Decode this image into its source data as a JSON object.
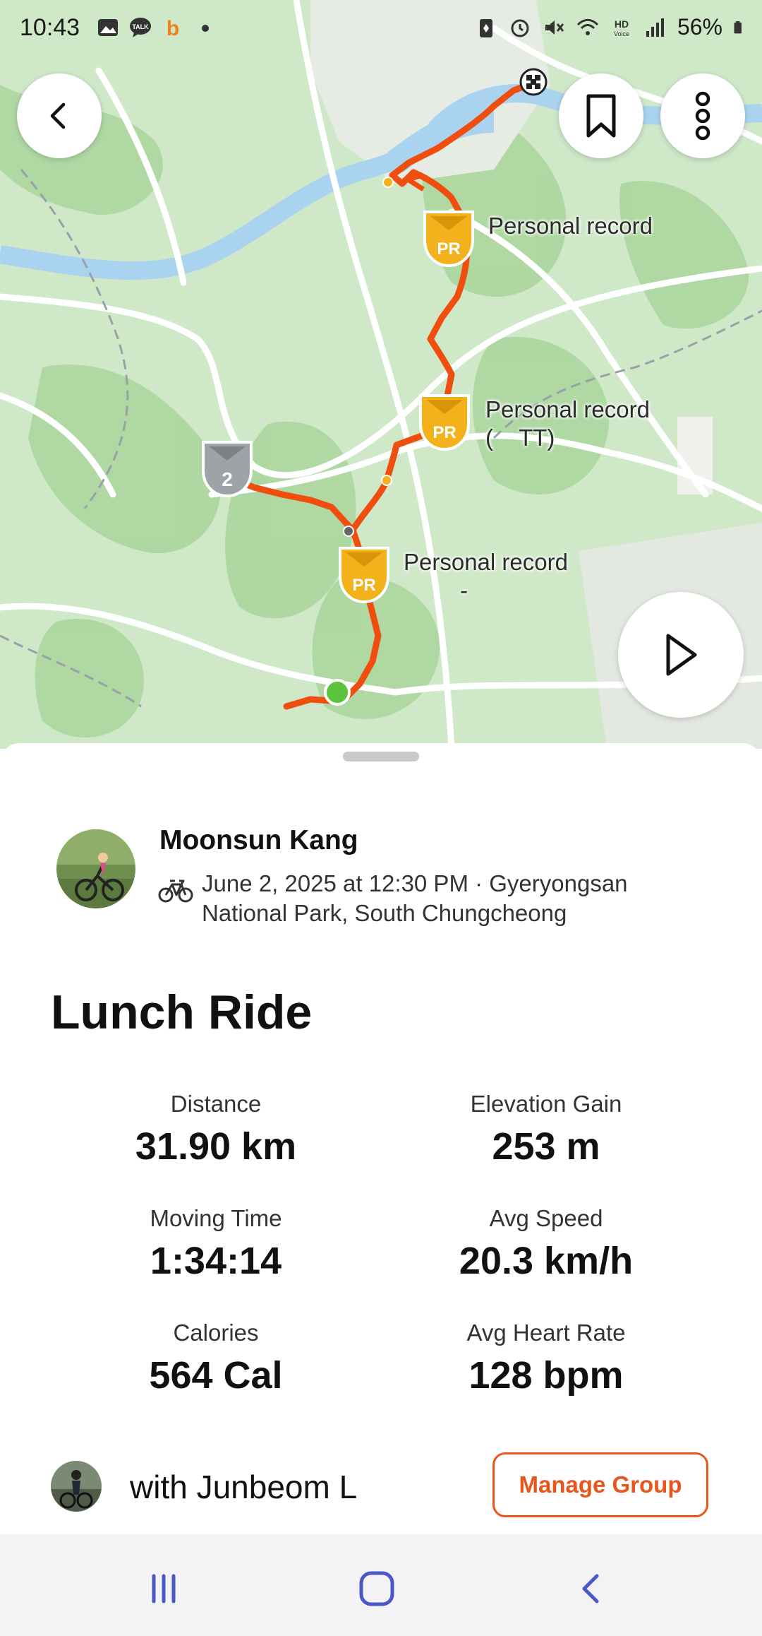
{
  "status_bar": {
    "time": "10:43",
    "battery": "56%",
    "notification_icons": [
      "gallery-icon",
      "talk-icon",
      "b-app-icon",
      "dot-icon"
    ],
    "system_icons": [
      "battery-saver-icon",
      "alarm-icon",
      "mute-icon",
      "wifi-icon",
      "hd-voice-icon",
      "signal-icon",
      "battery-icon"
    ]
  },
  "map": {
    "route_color": "#f04e0f",
    "segments": [
      {
        "label": "Personal record",
        "sublabel": ""
      },
      {
        "label": "Personal record",
        "sublabel": "(    TT)"
      },
      {
        "label": "Personal record",
        "sublabel": "-"
      }
    ],
    "medal_badge": "2",
    "pr_badge_text": "PR"
  },
  "athlete": {
    "name": "Moonsun Kang",
    "meta_line1": "June 2, 2025 at 12:30 PM · Gyeryongsan",
    "meta_line2": "National Park, South Chungcheong"
  },
  "activity": {
    "title": "Lunch Ride",
    "stats": [
      {
        "label": "Distance",
        "value": "31.90 km"
      },
      {
        "label": "Elevation Gain",
        "value": "253 m"
      },
      {
        "label": "Moving Time",
        "value": "1:34:14"
      },
      {
        "label": "Avg Speed",
        "value": "20.3 km/h"
      },
      {
        "label": "Calories",
        "value": "564 Cal"
      },
      {
        "label": "Avg Heart Rate",
        "value": "128 bpm"
      }
    ]
  },
  "group": {
    "text": "with Junbeom L",
    "manage_label": "Manage Group"
  },
  "colors": {
    "accent": "#e8561c",
    "map_green": "#cfe8c8",
    "water": "#a9d3ef"
  }
}
